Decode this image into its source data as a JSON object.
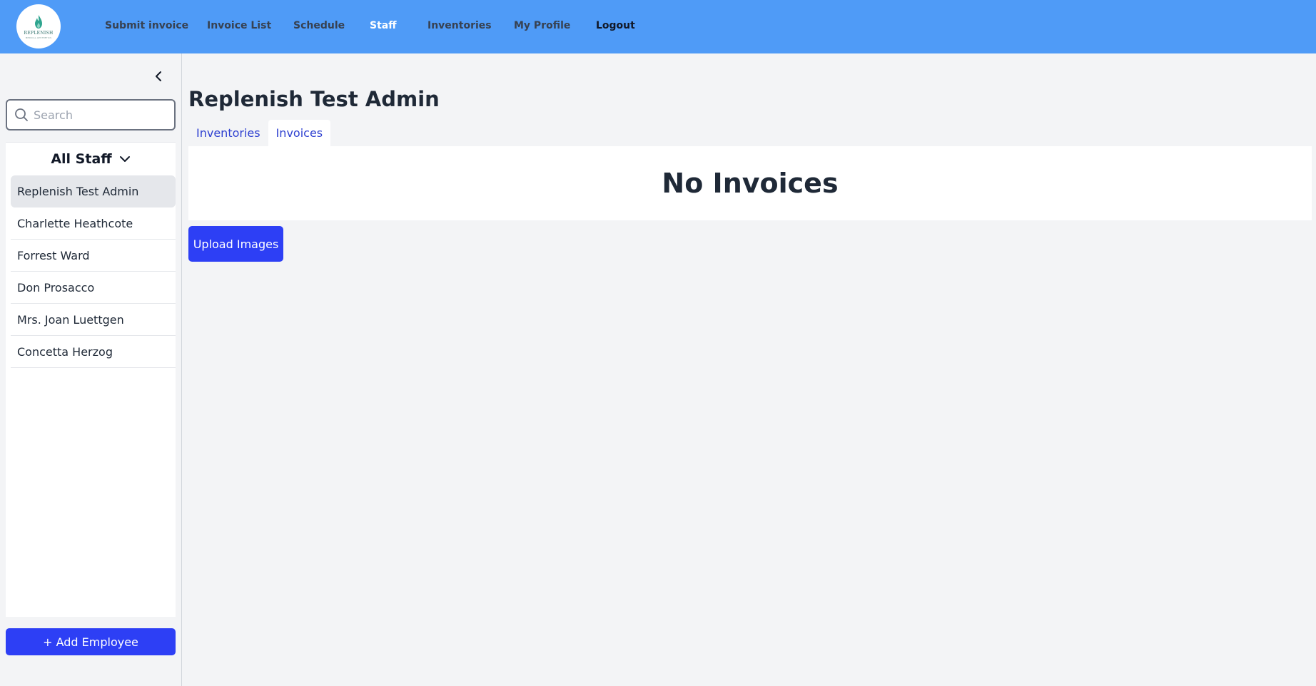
{
  "app": {
    "logo_text": "REPLENISH",
    "logo_sub": "MEDICAL AESTHETICS"
  },
  "nav": {
    "items": [
      {
        "label": "Submit invoice"
      },
      {
        "label": "Invoice List"
      },
      {
        "label": "Schedule"
      },
      {
        "label": "Staff",
        "active": true
      },
      {
        "label": "Inventories"
      },
      {
        "label": "My Profile"
      },
      {
        "label": "Logout"
      }
    ]
  },
  "sidebar": {
    "search_placeholder": "Search",
    "search_value": "",
    "filter_label": "All Staff",
    "staff": [
      {
        "name": "Replenish Test Admin",
        "selected": true
      },
      {
        "name": "Charlette Heathcote"
      },
      {
        "name": "Forrest Ward"
      },
      {
        "name": "Don Prosacco"
      },
      {
        "name": "Mrs. Joan Luettgen"
      },
      {
        "name": "Concetta Herzog"
      }
    ],
    "add_button_label": "+ Add Employee"
  },
  "main": {
    "title": "Replenish Test Admin",
    "tabs": [
      {
        "label": "Inventories"
      },
      {
        "label": "Invoices",
        "active": true
      }
    ],
    "empty_message": "No Invoices",
    "upload_button_label": "Upload Images"
  },
  "colors": {
    "navbar": "#4f9bf7",
    "primary_button": "#2d3ff5",
    "tab_text": "#2d3fd0",
    "background": "#f3f4f6"
  },
  "icons": {
    "collapse": "chevron-left-icon",
    "search": "search-icon",
    "filter": "chevron-down-icon",
    "logo": "flame-logo-icon"
  }
}
